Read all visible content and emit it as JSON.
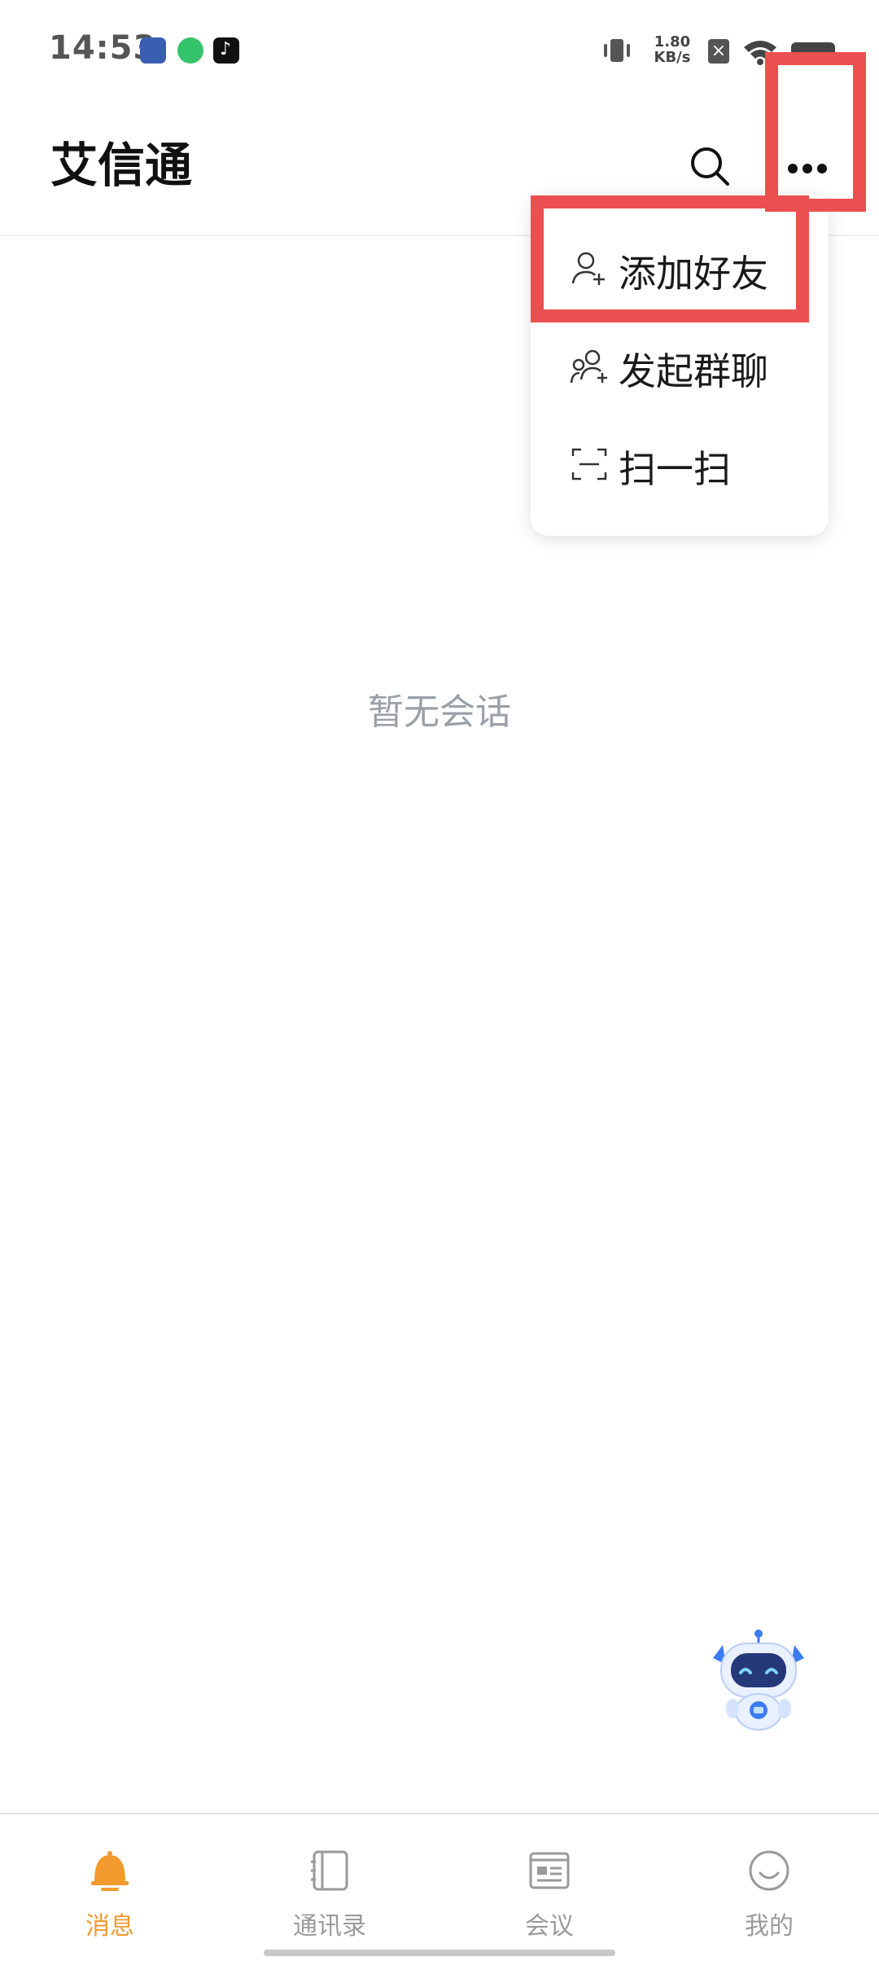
{
  "status_bar": {
    "time": "14:53",
    "net_speed_value": "1.80",
    "net_speed_unit": "KB/s",
    "icons": [
      "app-icon",
      "android-icon",
      "tiktok-icon",
      "vibrate-icon",
      "close-box-icon",
      "wifi-icon",
      "battery-icon"
    ]
  },
  "header": {
    "title": "艾信通",
    "search_icon": "search-icon",
    "more_icon": "more-icon"
  },
  "menu": {
    "items": [
      {
        "label": "添加好友",
        "icon": "add-friend-icon"
      },
      {
        "label": "发起群聊",
        "icon": "group-chat-icon"
      },
      {
        "label": "扫一扫",
        "icon": "scan-icon"
      }
    ]
  },
  "main": {
    "empty_text": "暂无会话"
  },
  "bottom_nav": {
    "items": [
      {
        "label": "消息",
        "icon": "bell-icon",
        "active": true
      },
      {
        "label": "通讯录",
        "icon": "contacts-book-icon",
        "active": false
      },
      {
        "label": "会议",
        "icon": "meeting-icon",
        "active": false
      },
      {
        "label": "我的",
        "icon": "smile-icon",
        "active": false
      }
    ]
  },
  "colors": {
    "accent": "#f29a2e",
    "highlight": "#ec4f4f",
    "muted_text": "#9aa0a6",
    "robot_blue": "#3d7bf2"
  }
}
